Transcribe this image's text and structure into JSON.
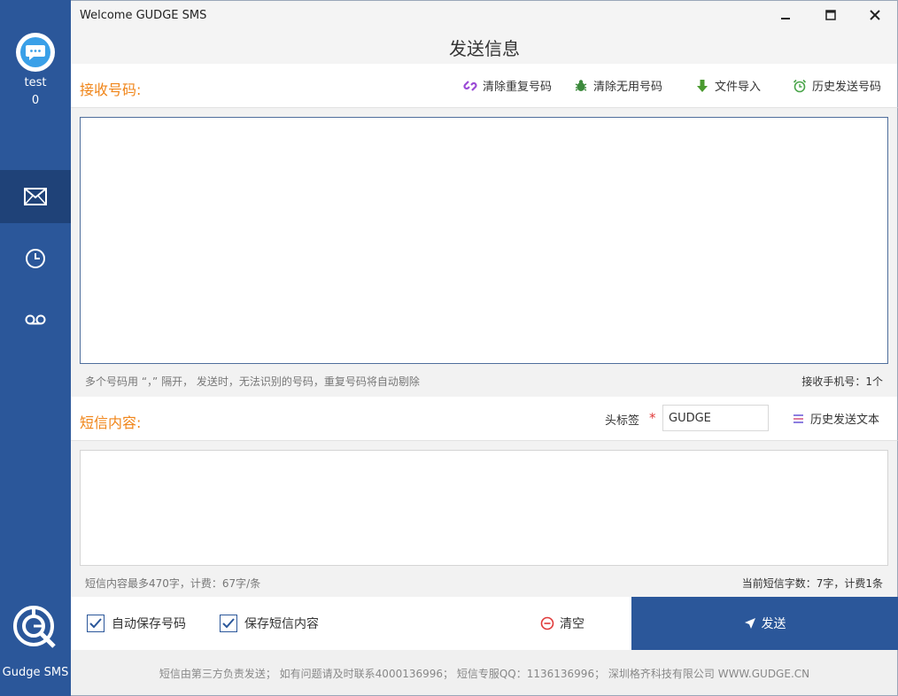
{
  "window": {
    "app_title": "Welcome GUDGE SMS",
    "page_title": "发送信息"
  },
  "sidebar": {
    "user_name": "test",
    "user_count": "0",
    "nav": [
      {
        "name": "messages",
        "icon": "mail-icon",
        "active": true
      },
      {
        "name": "history",
        "icon": "clock-icon",
        "active": false
      },
      {
        "name": "voice",
        "icon": "voicemail-icon",
        "active": false
      }
    ],
    "brand": "Gudge SMS"
  },
  "recipients": {
    "label": "接收号码:",
    "tools": {
      "dedupe": "清除重复号码",
      "clean_invalid": "清除无用号码",
      "import_file": "文件导入",
      "history_numbers": "历史发送号码"
    },
    "value": "",
    "hint": "多个号码用 “，” 隔开， 发送时，无法识别的号码，重复号码将自动剔除",
    "count_text": "接收手机号：1个"
  },
  "sms": {
    "label": "短信内容:",
    "tag_label": "头标签",
    "tag_required_mark": "*",
    "tag_value": "GUDGE",
    "history_text": "历史发送文本",
    "value": "",
    "limit_hint": "短信内容最多470字，计费：67字/条",
    "count_text": "当前短信字数：7字，计费1条"
  },
  "actions": {
    "auto_save_numbers": "自动保存号码",
    "auto_save_numbers_checked": true,
    "save_sms_content": "保存短信内容",
    "save_sms_content_checked": true,
    "clear": "清空",
    "send": "发送"
  },
  "footer": {
    "text": "短信由第三方负责发送；  如有问题请及时联系4000136996；  短信专服QQ：1136136996；  深圳格齐科技有限公司 WWW.GUDGE.CN"
  },
  "colors": {
    "sidebar_bg": "#2b579a",
    "sidebar_active": "#1f4278",
    "section_label": "#f08519",
    "send_bg": "#2b579a"
  }
}
